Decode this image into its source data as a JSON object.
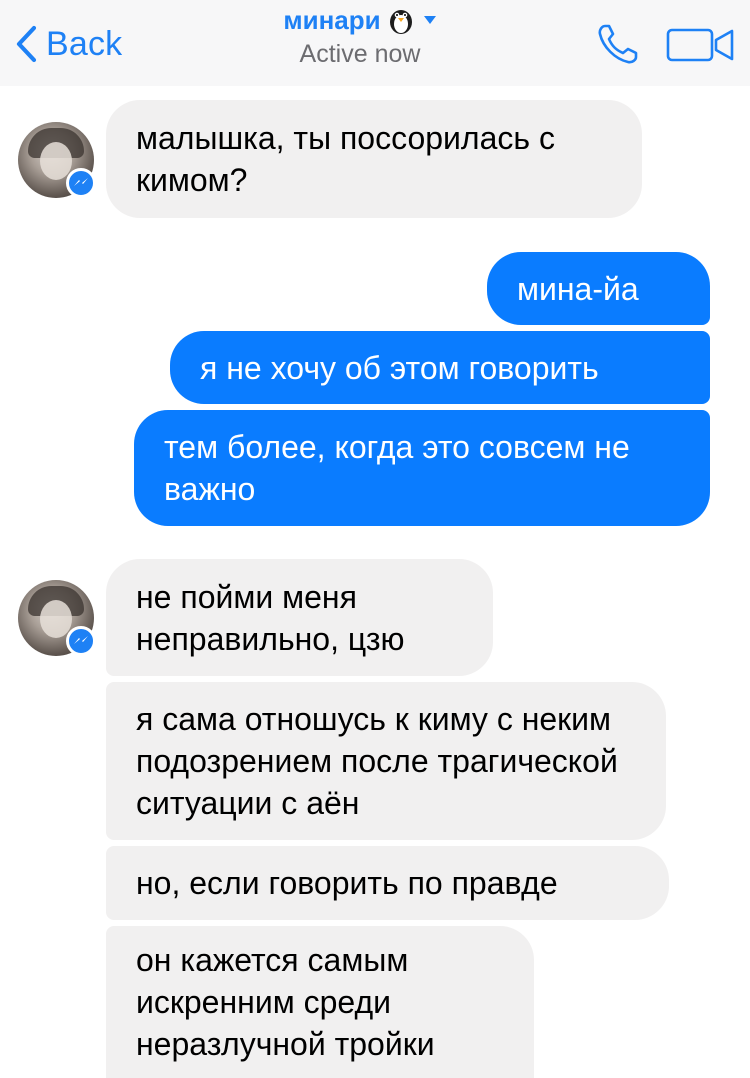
{
  "header": {
    "back_label": "Back",
    "contact_name": "минари",
    "status": "Active now",
    "accent_color": "#1e81f5",
    "icons": [
      "chevron-left-icon",
      "penguin-emoji-icon",
      "caret-down-icon",
      "phone-icon",
      "video-camera-icon"
    ]
  },
  "messages": [
    {
      "from": "contact",
      "text": "малышка, ты поссорилась с кимом?"
    },
    {
      "from": "me",
      "text": "мина-йа"
    },
    {
      "from": "me",
      "text": "я не хочу об этом говорить"
    },
    {
      "from": "me",
      "text": "тем более, когда это совсем не важно"
    },
    {
      "from": "contact",
      "text": "не пойми меня неправильно, цзю"
    },
    {
      "from": "contact",
      "text": "я сама отношусь к киму с неким подозрением после трагической ситуации с аён"
    },
    {
      "from": "contact",
      "text": "но, если говорить по правде"
    },
    {
      "from": "contact",
      "text": "он кажется самым искренним среди неразлучной тройки"
    }
  ],
  "colors": {
    "incoming_bubble": "#f1f0f0",
    "outgoing_bubble": "#0a7cff",
    "header_bg": "#f7f7f8",
    "messenger_badge": "#1e81f5"
  }
}
